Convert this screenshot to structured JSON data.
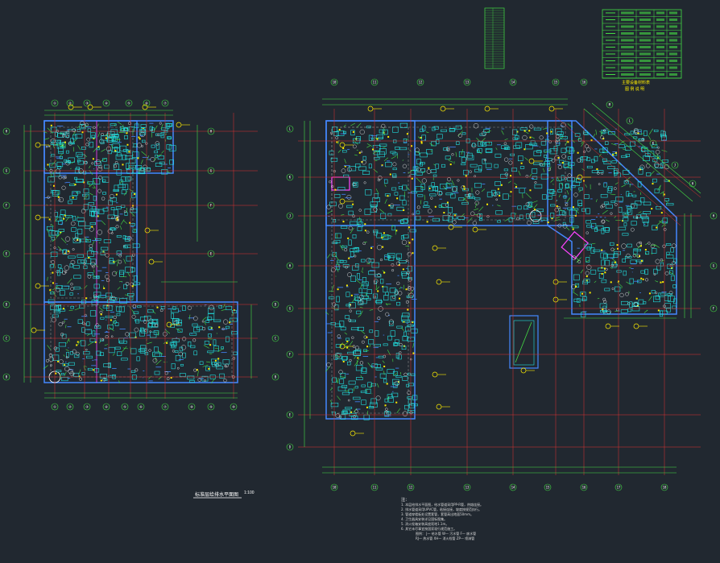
{
  "drawing": {
    "background": "#212830",
    "colors": {
      "grid_axis": "#e23030",
      "dimension": "#44dd44",
      "wall": "#4488ff",
      "furniture": "#22e0e0",
      "annotation": "#ffee00",
      "highlight": "#ff44ff",
      "text": "#ffffff"
    },
    "left_plan": {
      "title": "标准层给排水平面图",
      "scale": "1:100",
      "top_axes": [
        "①",
        "②",
        "③",
        "④",
        "⑤",
        "⑥",
        "⑦"
      ],
      "bottom_axes": [
        "①",
        "②",
        "③",
        "④",
        "⑤",
        "⑥",
        "⑦",
        "⑧",
        "⑨",
        "⑩"
      ],
      "side_axes": [
        "H",
        "G",
        "F",
        "E",
        "D",
        "C",
        "B",
        "A"
      ]
    },
    "right_plan": {
      "top_axes": [
        "10",
        "11",
        "12",
        "13",
        "14",
        "15",
        "16"
      ],
      "bottom_axes": [
        "10",
        "11",
        "12",
        "13",
        "14",
        "15",
        "16",
        "17",
        "18",
        "19"
      ],
      "side_axes": [
        "M",
        "L",
        "K",
        "J",
        "H",
        "G",
        "F",
        "E",
        "D",
        "C",
        "B",
        "A"
      ]
    },
    "legend_table": {
      "title": "主要设备材料表",
      "subtitle": "图 例 说 明",
      "rows": 10
    },
    "notes": {
      "heading": "注：",
      "lines": [
        "1. 本层给排水平面图，给水管道采用PP-R管，热熔连接。",
        "2. 排水管道采用UPVC管，粘接连接，坡度按规范执行。",
        "3. 管道穿楼板处设置套管，套管高出地面50mm。",
        "4. 卫生器具安装详见国标图集。",
        "5. 消火栓箱安装高度距地1.1m。",
        "6. 其它未尽事宜按国家现行规范施工。",
        "图例： J— 给水管  W— 污水管  F— 废水管",
        "RJ— 热水管  XH— 消火栓管  ZP— 喷淋管"
      ]
    }
  }
}
